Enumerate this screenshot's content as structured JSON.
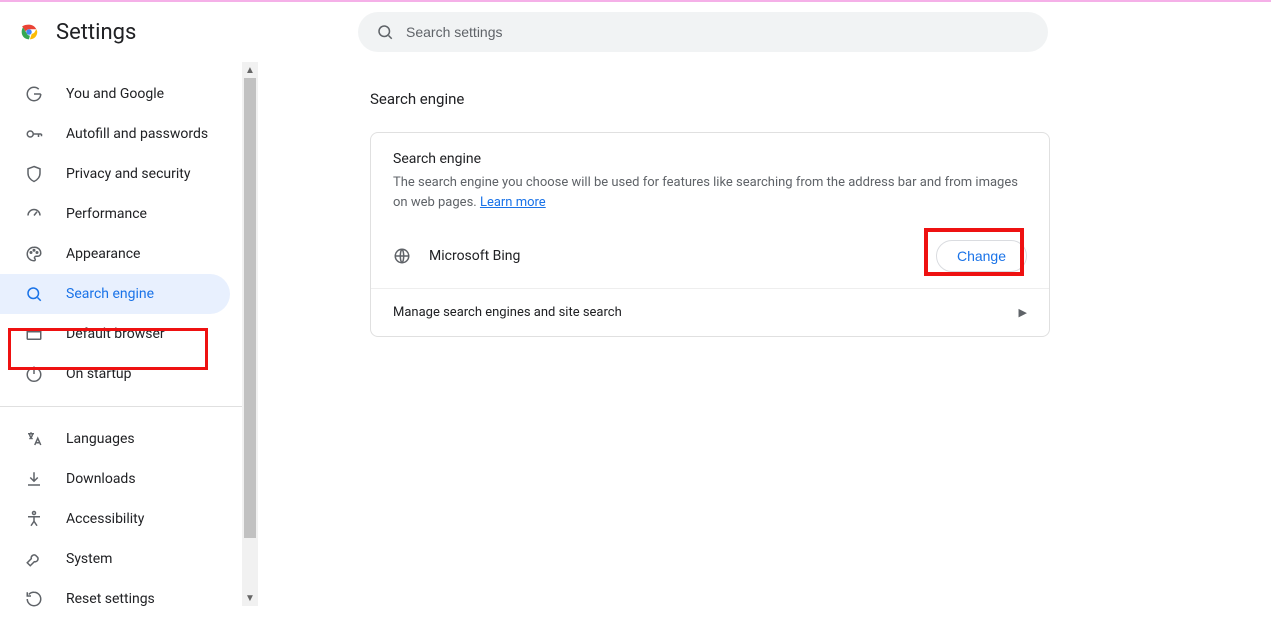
{
  "header": {
    "title": "Settings",
    "search_placeholder": "Search settings"
  },
  "sidebar": {
    "items": [
      {
        "id": "you-google",
        "label": "You and Google"
      },
      {
        "id": "autofill",
        "label": "Autofill and passwords"
      },
      {
        "id": "privacy",
        "label": "Privacy and security"
      },
      {
        "id": "performance",
        "label": "Performance"
      },
      {
        "id": "appearance",
        "label": "Appearance"
      },
      {
        "id": "search-engine",
        "label": "Search engine",
        "active": true
      },
      {
        "id": "default-browser",
        "label": "Default browser"
      },
      {
        "id": "on-startup",
        "label": "On startup"
      }
    ],
    "items2": [
      {
        "id": "languages",
        "label": "Languages"
      },
      {
        "id": "downloads",
        "label": "Downloads"
      },
      {
        "id": "accessibility",
        "label": "Accessibility"
      },
      {
        "id": "system",
        "label": "System"
      },
      {
        "id": "reset",
        "label": "Reset settings"
      }
    ]
  },
  "main": {
    "section_title": "Search engine",
    "card": {
      "title": "Search engine",
      "description_pre": "The search engine you choose will be used for features like searching from the address bar and from images on web pages. ",
      "learn_more": "Learn more",
      "current_engine": "Microsoft Bing",
      "change_label": "Change",
      "manage_label": "Manage search engines and site search"
    }
  },
  "annotations": {
    "highlight_sidebar_item": "search-engine",
    "highlight_change_button": true
  }
}
